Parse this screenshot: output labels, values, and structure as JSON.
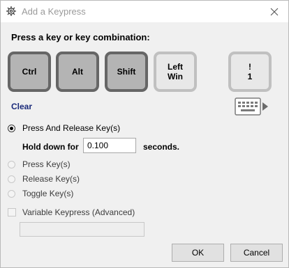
{
  "window": {
    "title": "Add a Keypress"
  },
  "prompt": "Press a key or key combination:",
  "keys": [
    {
      "label": "Ctrl",
      "active": true
    },
    {
      "label": "Alt",
      "active": true
    },
    {
      "label": "Shift",
      "active": true
    },
    {
      "label": "Left\nWin",
      "active": false
    }
  ],
  "selected_key": {
    "label": "!\n1"
  },
  "clear_label": "Clear",
  "options": {
    "press_and_release": "Press And Release Key(s)",
    "hold_down_label": "Hold down for",
    "hold_down_value": "0.100",
    "seconds_label": "seconds.",
    "press": "Press Key(s)",
    "release": "Release Key(s)",
    "toggle": "Toggle Key(s)",
    "selected": "press_and_release"
  },
  "variable_keypress": {
    "label": "Variable Keypress (Advanced)",
    "checked": false,
    "value": ""
  },
  "buttons": {
    "ok": "OK",
    "cancel": "Cancel"
  },
  "colors": {
    "key_active_fill": "#b4b4b4",
    "key_active_border": "#666666",
    "key_inactive_fill": "#e8e8e8",
    "key_inactive_border": "#c0c0c0",
    "link": "#1a2a7a"
  },
  "icons": {
    "app": "gear-icon",
    "close": "close-icon",
    "keyboard": "keyboard-icon"
  }
}
